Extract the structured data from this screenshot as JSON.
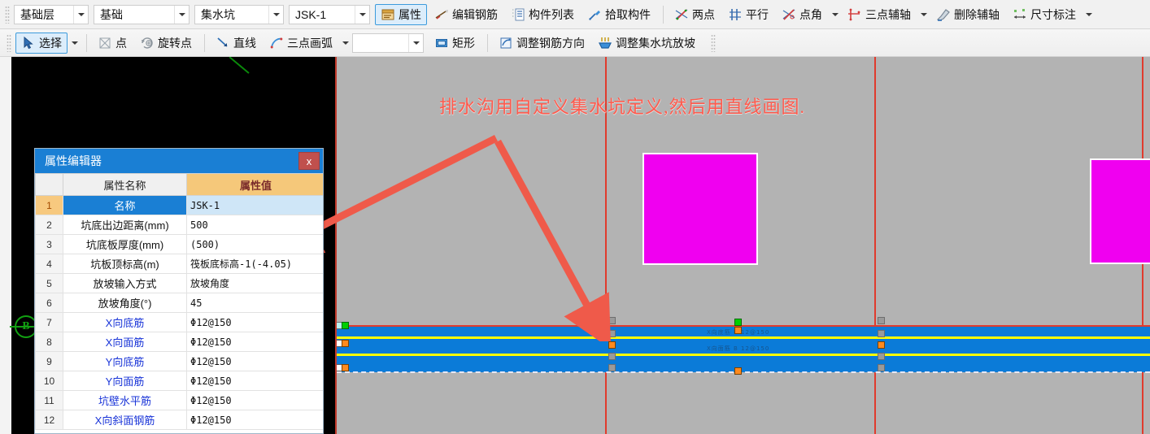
{
  "toolbar_top": {
    "combos": [
      {
        "name": "floor-level",
        "value": "基础层"
      },
      {
        "name": "component-category",
        "value": "基础"
      },
      {
        "name": "component-type",
        "value": "集水坑"
      },
      {
        "name": "component-name",
        "value": "JSK-1"
      }
    ],
    "buttons": [
      {
        "name": "properties",
        "label": "属性",
        "icon": "properties-icon",
        "active": true,
        "caret": false
      },
      {
        "name": "edit-rebar",
        "label": "编辑钢筋",
        "icon": "edit-rebar-icon",
        "active": false,
        "caret": false
      },
      {
        "name": "component-list",
        "label": "构件列表",
        "icon": "component-list-icon",
        "active": false,
        "caret": false
      },
      {
        "name": "pick-component",
        "label": "拾取构件",
        "icon": "eyedropper-icon",
        "active": false,
        "caret": false
      },
      {
        "name": "two-point",
        "label": "两点",
        "icon": "two-point-axis-icon",
        "active": false,
        "caret": false
      },
      {
        "name": "parallel",
        "label": "平行",
        "icon": "parallel-axis-icon",
        "active": false,
        "caret": false
      },
      {
        "name": "point-angle",
        "label": "点角",
        "icon": "point-angle-icon",
        "active": false,
        "caret": true
      },
      {
        "name": "three-point-axis",
        "label": "三点辅轴",
        "icon": "three-point-axis-icon",
        "active": false,
        "caret": true
      },
      {
        "name": "delete-aux-axis",
        "label": "删除辅轴",
        "icon": "eraser-icon",
        "active": false,
        "caret": false
      },
      {
        "name": "dimension",
        "label": "尺寸标注",
        "icon": "dimension-icon",
        "active": false,
        "caret": true
      }
    ]
  },
  "toolbar_second": {
    "buttons": [
      {
        "name": "select",
        "label": "选择",
        "icon": "cursor-icon",
        "active": true,
        "caret": true
      },
      {
        "name": "point",
        "label": "点",
        "icon": "point-icon",
        "active": false,
        "caret": false
      },
      {
        "name": "rotate-point",
        "label": "旋转点",
        "icon": "rotate-point-icon",
        "active": false,
        "caret": false
      },
      {
        "name": "line",
        "label": "直线",
        "icon": "line-icon",
        "active": false,
        "caret": false
      },
      {
        "name": "three-point-arc",
        "label": "三点画弧",
        "icon": "arc-icon",
        "active": false,
        "caret": true
      }
    ],
    "blank_combo_value": "",
    "buttons2": [
      {
        "name": "rectangle",
        "label": "矩形",
        "icon": "rectangle-icon",
        "active": false,
        "caret": false
      },
      {
        "name": "adjust-rebar-direction",
        "label": "调整钢筋方向",
        "icon": "adjust-rebar-icon",
        "active": false,
        "caret": false
      },
      {
        "name": "adjust-sump-slope",
        "label": "调整集水坑放坡",
        "icon": "sump-slope-icon",
        "active": false,
        "caret": false
      }
    ]
  },
  "annotation": {
    "text": "排水沟用自定义集水坑定义,然后用直线画图.",
    "color": "#ff5a4d",
    "arrow_color": "#ef5a4a"
  },
  "canvas": {
    "background_color": "#b3b3b3",
    "dark_region_color": "#000000",
    "grid_color": "#e03b2d",
    "magenta_color": "#f000f0",
    "band_color": "#0b7bd8",
    "rebar_line_color": "#ffff00",
    "axis_bubble_label": "B",
    "axis_bubble_color": "#12a012",
    "rebar_labels": [
      "X向底筋 B 12@150",
      "X向面筋 B 12@150"
    ]
  },
  "property_editor": {
    "title": "属性编辑器",
    "close_label": "x",
    "headers": {
      "index": "",
      "name": "属性名称",
      "value": "属性值"
    },
    "rows": [
      {
        "index": "1",
        "name": "名称",
        "value": "JSK-1",
        "selected": true,
        "link": false
      },
      {
        "index": "2",
        "name": "坑底出边距离(mm)",
        "value": "500",
        "selected": false,
        "link": false
      },
      {
        "index": "3",
        "name": "坑底板厚度(mm)",
        "value": "(500)",
        "selected": false,
        "link": false
      },
      {
        "index": "4",
        "name": "坑板顶标高(m)",
        "value": "筏板底标高-1(-4.05)",
        "selected": false,
        "link": false
      },
      {
        "index": "5",
        "name": "放坡输入方式",
        "value": "放坡角度",
        "selected": false,
        "link": false
      },
      {
        "index": "6",
        "name": "放坡角度(°)",
        "value": "45",
        "selected": false,
        "link": false
      },
      {
        "index": "7",
        "name": "X向底筋",
        "value": "Φ12@150",
        "selected": false,
        "link": true
      },
      {
        "index": "8",
        "name": "X向面筋",
        "value": "Φ12@150",
        "selected": false,
        "link": true
      },
      {
        "index": "9",
        "name": "Y向底筋",
        "value": "Φ12@150",
        "selected": false,
        "link": true
      },
      {
        "index": "10",
        "name": "Y向面筋",
        "value": "Φ12@150",
        "selected": false,
        "link": true
      },
      {
        "index": "11",
        "name": "坑壁水平筋",
        "value": "Φ12@150",
        "selected": false,
        "link": true
      },
      {
        "index": "12",
        "name": "X向斜面钢筋",
        "value": "Φ12@150",
        "selected": false,
        "link": true
      }
    ]
  }
}
